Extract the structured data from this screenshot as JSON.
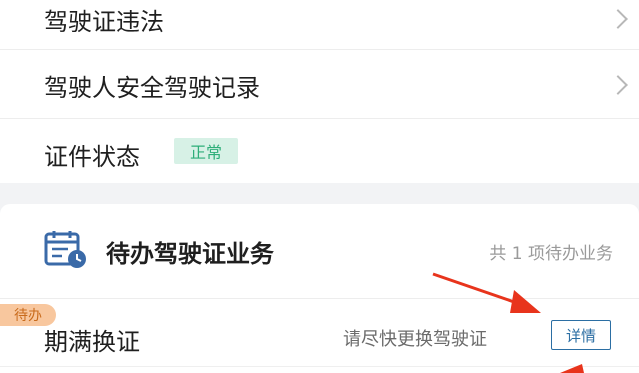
{
  "menu": {
    "items": [
      {
        "label": "驾驶证违法"
      },
      {
        "label": "驾驶人安全驾驶记录"
      }
    ],
    "status": {
      "label": "证件状态",
      "badge": "正常"
    }
  },
  "todo": {
    "title": "待办驾驶证业务",
    "count_text": "共 1 项待办业务",
    "item": {
      "badge": "待办",
      "label": "期满换证",
      "desc": "请尽快更换驾驶证",
      "button": "详情"
    }
  },
  "icons": {
    "chevron": "chevron-right-icon",
    "todo": "calendar-clock-icon"
  },
  "colors": {
    "ok_badge_bg": "#d7f1e6",
    "ok_badge_text": "#2eae79",
    "pending_badge_bg": "#f8c79e",
    "button_accent": "#2b6ea3",
    "annotation_arrow": "#e8341c"
  }
}
